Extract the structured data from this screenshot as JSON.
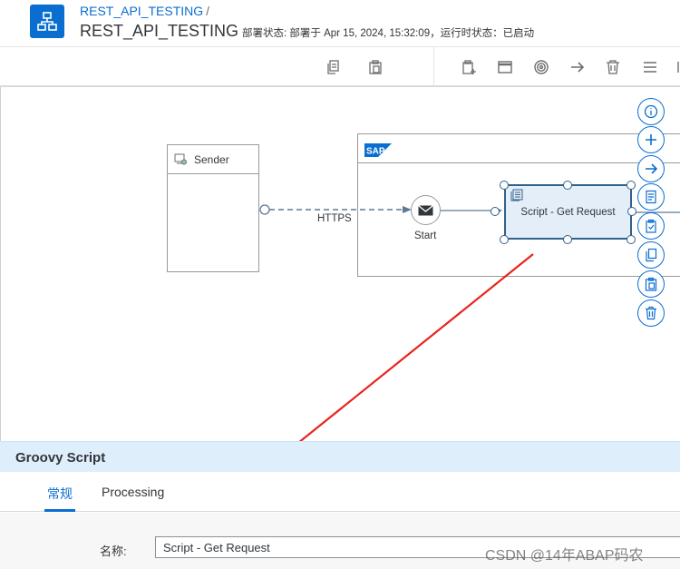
{
  "header": {
    "breadcrumb": "REST_API_TESTING",
    "breadcrumb_sep": "/",
    "title": "REST_API_TESTING",
    "status": "部署状态: 部署于 Apr 15, 2024, 15:32:09，运行时状态：已启动"
  },
  "toolbar": {
    "buttons": [
      "copy-icon",
      "paste-icon",
      "paste-step-icon",
      "window-icon",
      "target-icon",
      "arrow-right-icon",
      "delete-icon",
      "menu-icon"
    ]
  },
  "canvas": {
    "sender_label": "Sender",
    "connection_label": "HTTPS",
    "start_label": "Start",
    "script_step_label": "Script - Get Request",
    "pool_logo": "SAP",
    "context_buttons": [
      "info-icon",
      "add-icon",
      "connect-icon",
      "notes-icon",
      "task-icon",
      "copy-icon",
      "paste-icon",
      "delete-icon"
    ]
  },
  "panel": {
    "title": "Groovy Script",
    "tabs": [
      {
        "label": "常规",
        "active": true
      },
      {
        "label": "Processing",
        "active": false
      }
    ],
    "name_label": "名称:",
    "name_value": "Script - Get Request"
  },
  "watermark": "CSDN @14年ABAP码农",
  "colors": {
    "accent": "#0a6ed1",
    "step_border": "#346187",
    "step_fill": "#e3eef9",
    "panel_header": "#dfeefb",
    "annotation_arrow": "#e8231d"
  }
}
